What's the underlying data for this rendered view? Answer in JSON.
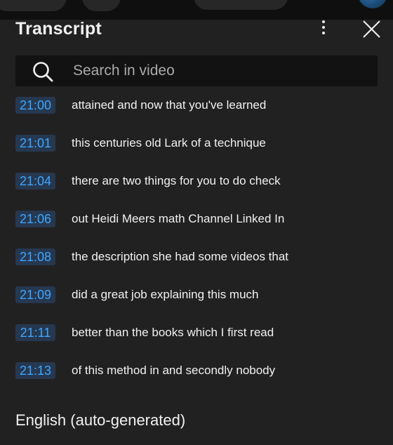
{
  "panel": {
    "title": "Transcript",
    "search": {
      "placeholder": "Search in video",
      "value": ""
    },
    "segments": [
      {
        "time": "21:00",
        "text": "attained and now that you've learned"
      },
      {
        "time": "21:01",
        "text": "this centuries old Lark of a technique"
      },
      {
        "time": "21:04",
        "text": "there are two things for you to do check"
      },
      {
        "time": "21:06",
        "text": "out Heidi Meers math Channel Linked In"
      },
      {
        "time": "21:08",
        "text": "the description she had some videos that"
      },
      {
        "time": "21:09",
        "text": "did a great job explaining this much"
      },
      {
        "time": "21:11",
        "text": "better than the books which I first read"
      },
      {
        "time": "21:13",
        "text": "of this method in and secondly nobody"
      }
    ],
    "language": "English (auto-generated)"
  },
  "colors": {
    "panel_bg": "#212121",
    "timestamp_bg": "#263850",
    "timestamp_text": "#3ea6ff",
    "text": "#f1f1f1"
  },
  "icons": [
    "search-icon",
    "more-vert-icon",
    "close-icon"
  ]
}
